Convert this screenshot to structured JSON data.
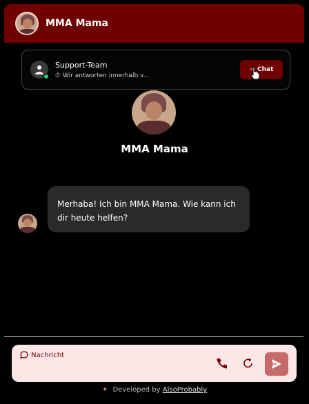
{
  "header": {
    "title": "MMA Mama",
    "avatar_icon": "avatar-icon"
  },
  "support": {
    "name": "Support-Team",
    "status": "Wir antworten innerhalb v...",
    "status_icon": "timer-icon",
    "chat_button_label": "Chat",
    "online_color": "#2ecc71"
  },
  "profile": {
    "name": "MMA Mama"
  },
  "messages": [
    {
      "sender": "bot",
      "text": "Merhaba! Ich bin MMA Mama. Wie kann ich dir heute helfen?"
    }
  ],
  "composer": {
    "placeholder": "Nachricht",
    "call_icon": "phone-icon",
    "redo_icon": "redo-icon",
    "send_icon": "send-icon"
  },
  "footer": {
    "prefix": "Developed by",
    "link": "AlsoProbably"
  },
  "colors": {
    "brand": "#700000",
    "input_bg": "#fde6e6",
    "send_bg": "#c66a6a"
  }
}
